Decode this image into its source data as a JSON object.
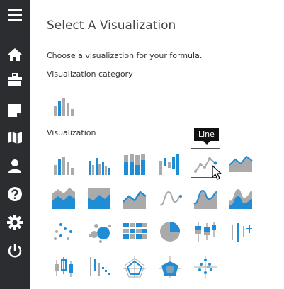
{
  "header": {
    "title": "Select A Visualization"
  },
  "description": "Choose a visualization for your formula.",
  "category": {
    "label": "Visualization category",
    "selected_icon": "bar-chart-icon"
  },
  "visualization": {
    "label": "Visualization",
    "tooltip": "Line",
    "hovered": "Line"
  },
  "sidebar": {
    "icons": [
      "menu-icon",
      "home-icon",
      "briefcase-icon",
      "note-icon",
      "map-icon",
      "user-icon",
      "help-icon",
      "settings-icon",
      "power-icon"
    ]
  },
  "colors": {
    "accent": "#1f8dd6",
    "gray": "#aaaaaa",
    "sidebar": "#2b2d31",
    "icon": "#ffffff"
  }
}
